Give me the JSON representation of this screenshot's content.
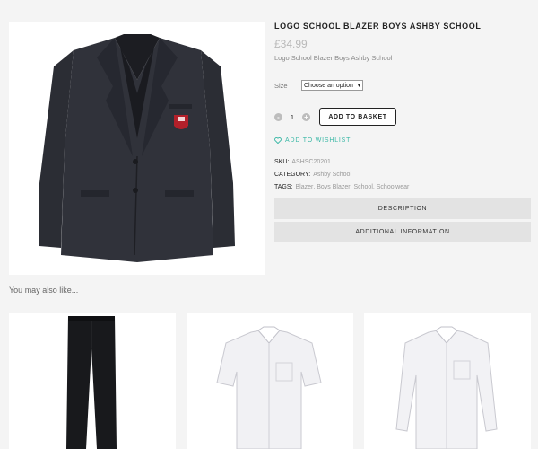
{
  "product": {
    "title": "LOGO SCHOOL BLAZER BOYS ASHBY SCHOOL",
    "price": "£34.99",
    "short_description": "Logo School Blazer Boys Ashby School",
    "size_label": "Size",
    "size_select_value": "Choose an option",
    "quantity": "1",
    "qty_minus": "-",
    "qty_plus": "+",
    "add_to_basket": "ADD TO BASKET",
    "wishlist": "ADD TO WISHLIST",
    "sku_key": "SKU:",
    "sku_value": "ASHSC20201",
    "category_key": "CATEGORY:",
    "category_value": "Ashby School",
    "tags_key": "TAGS:",
    "tags": [
      "Blazer",
      "Boys Blazer",
      "School",
      "Schoolwear"
    ]
  },
  "tabs": [
    "DESCRIPTION",
    "ADDITIONAL INFORMATION"
  ],
  "related": {
    "heading": "You may also like..."
  },
  "colors": {
    "accent": "#3ab8a6",
    "tab_bg": "#e3e3e3",
    "page_bg": "#f4f4f4"
  },
  "icons": {
    "wishlist": "heart-icon",
    "select": "chevron-down-icon"
  }
}
